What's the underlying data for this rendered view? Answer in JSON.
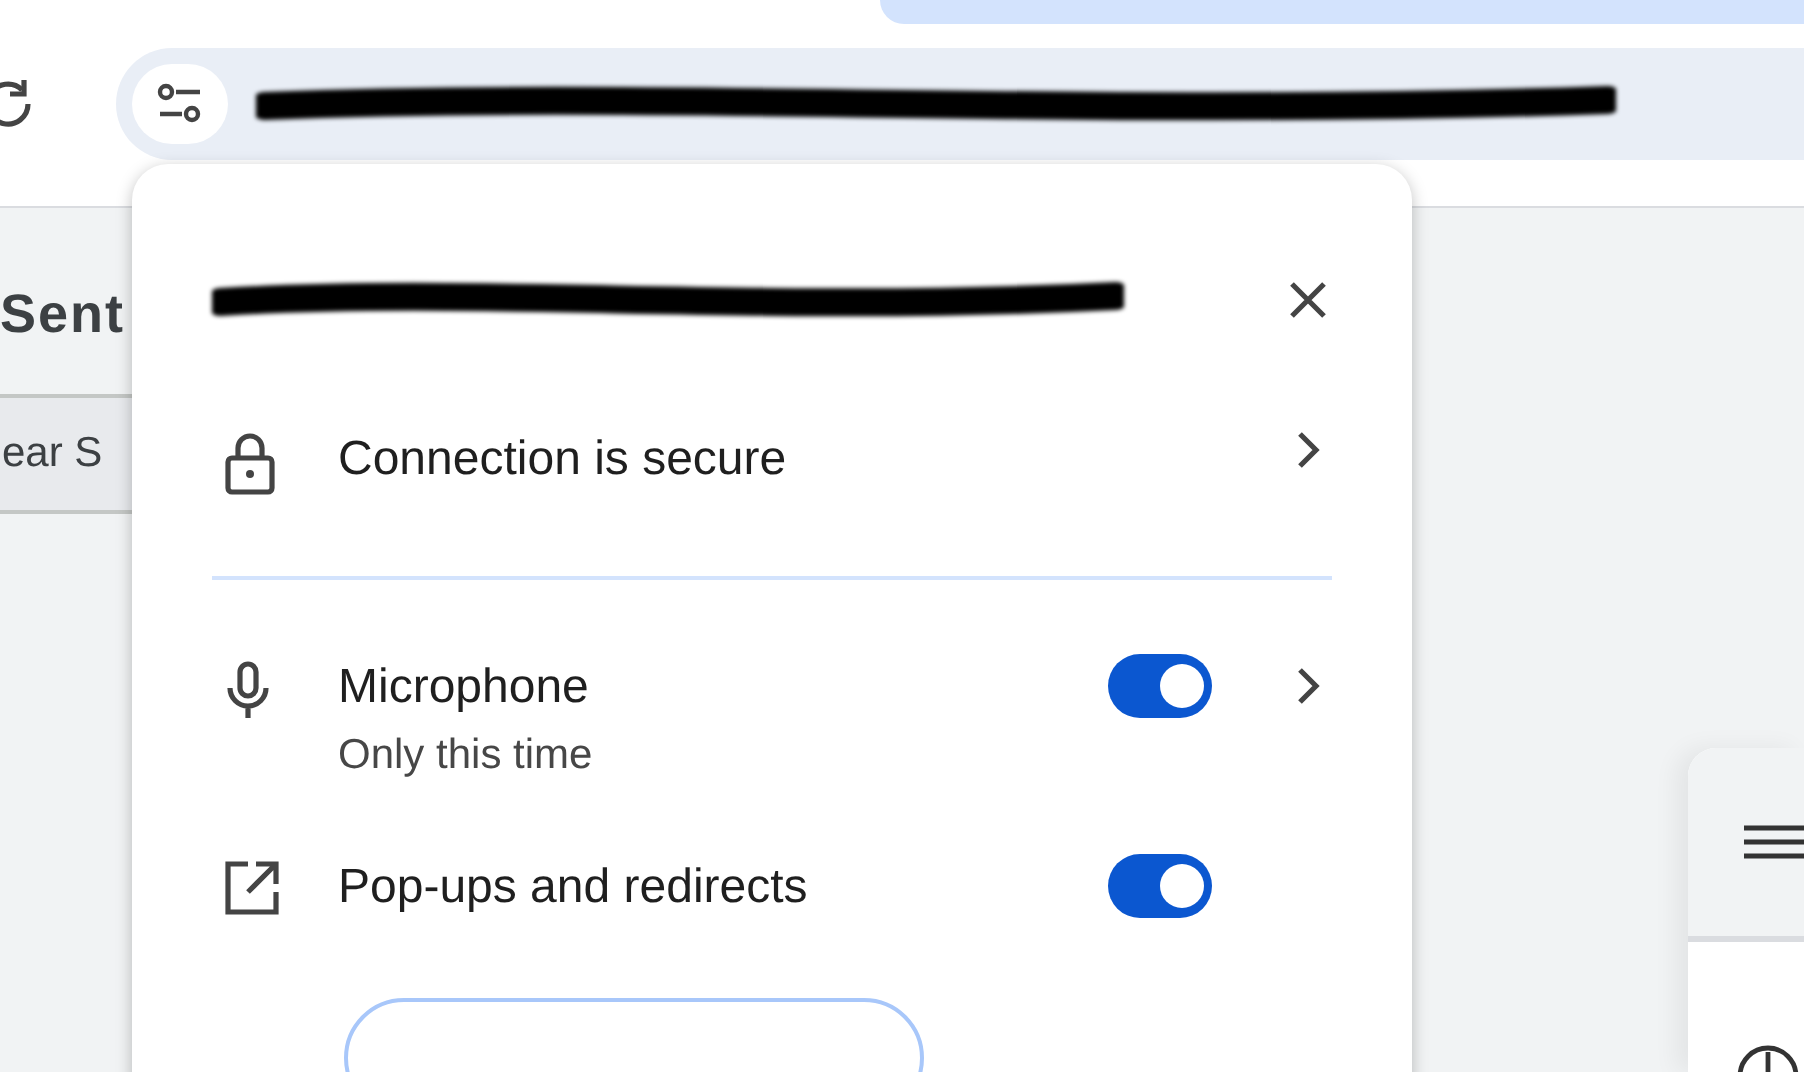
{
  "page": {
    "heading": "Sent",
    "search_fragment": "ear S"
  },
  "site_popup": {
    "rows": [
      {
        "kind": "link",
        "label": "Connection is secure"
      },
      {
        "kind": "permission",
        "label": "Microphone",
        "detail": "Only this time",
        "on": true,
        "has_details": true
      },
      {
        "kind": "permission",
        "label": "Pop-ups and redirects",
        "on": true,
        "has_details": false
      }
    ]
  }
}
